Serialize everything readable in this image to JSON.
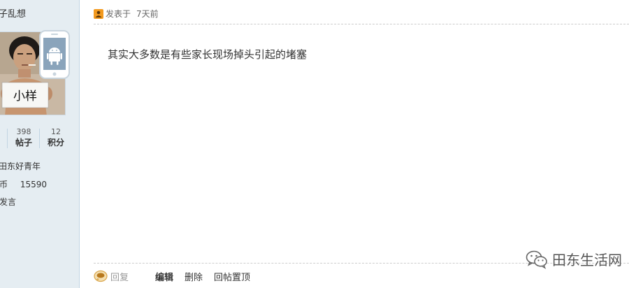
{
  "sidebar": {
    "username": "子乱想",
    "stats": [
      {
        "value": "398",
        "label": "帖子"
      },
      {
        "value": "12",
        "label": "积分"
      }
    ],
    "rank": "田东好青年",
    "coins_label": "币",
    "coins_value": "15590",
    "send_message": "发言",
    "avatar_sign_text": "小样"
  },
  "post": {
    "posted_label": "发表于",
    "posted_time": "7天前",
    "content": "其实大多数是有些家长现场掉头引起的堵塞"
  },
  "actions": {
    "reply": "回复",
    "edit": "编辑",
    "delete": "删除",
    "pin_reply": "回帖置顶"
  },
  "watermark": {
    "text": "田东生活网"
  },
  "colors": {
    "sidebar_bg": "#e5edf2",
    "sidebar_border": "#c2d5e3",
    "text": "#333333",
    "muted": "#999999"
  }
}
